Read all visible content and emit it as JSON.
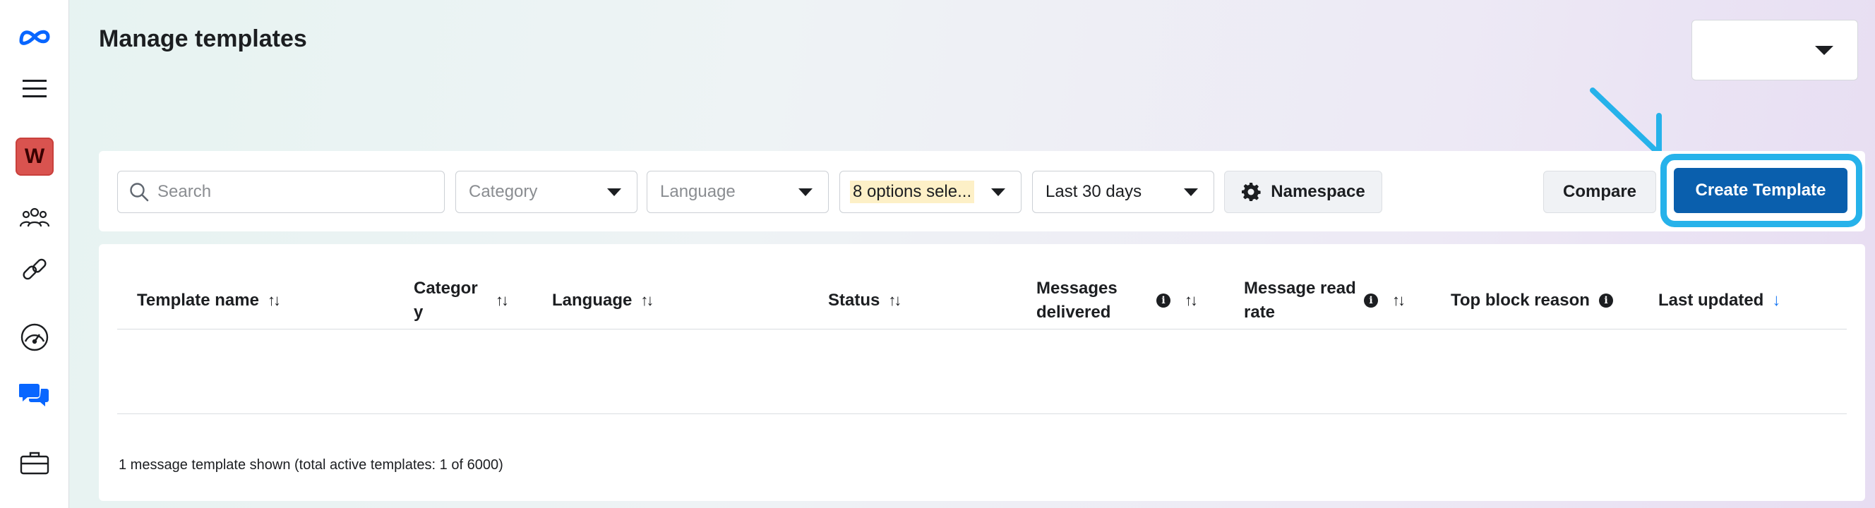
{
  "page": {
    "title": "Manage templates"
  },
  "account_select": {
    "value": ""
  },
  "rail": {
    "items": [
      {
        "name": "meta-logo-icon",
        "icon": "meta-infinity"
      },
      {
        "name": "menu-icon",
        "icon": "hamburger"
      },
      {
        "name": "workspace-badge",
        "label": "W"
      },
      {
        "name": "people-icon",
        "icon": "people-group"
      },
      {
        "name": "link-icon",
        "icon": "chain-link"
      },
      {
        "name": "dashboard-icon",
        "icon": "speedometer"
      },
      {
        "name": "chat-icon",
        "icon": "chat-bubbles",
        "active": true
      },
      {
        "name": "briefcase-icon",
        "icon": "briefcase"
      }
    ]
  },
  "filters": {
    "search_placeholder": "Search",
    "category": "Category",
    "language": "Language",
    "status": "8 options sele...",
    "date_range": "Last 30 days",
    "namespace_label": "Namespace",
    "compare_label": "Compare",
    "create_label": "Create Template"
  },
  "table": {
    "columns": [
      {
        "key": "template_name",
        "label": "Template name",
        "sort": "both"
      },
      {
        "key": "category",
        "label": "Categor y",
        "sort": "both"
      },
      {
        "key": "language",
        "label": "Language",
        "sort": "both"
      },
      {
        "key": "status",
        "label": "Status",
        "sort": "both"
      },
      {
        "key": "messages_delivered",
        "label": "Messages delivered",
        "info": true,
        "sort": "both"
      },
      {
        "key": "message_read_rate",
        "label": "Message read rate",
        "info": true,
        "sort": "both"
      },
      {
        "key": "top_block_reason",
        "label": "Top block reason",
        "info": true
      },
      {
        "key": "last_updated",
        "label": "Last updated",
        "sort": "desc"
      }
    ],
    "rows": [],
    "footer": "1 message template shown (total active templates: 1 of 6000)"
  },
  "colors": {
    "primary_button": "#0a5fad",
    "annotation": "#26b2ea",
    "workspace_badge": "#d9534f",
    "sort_active": "#1877f2"
  }
}
